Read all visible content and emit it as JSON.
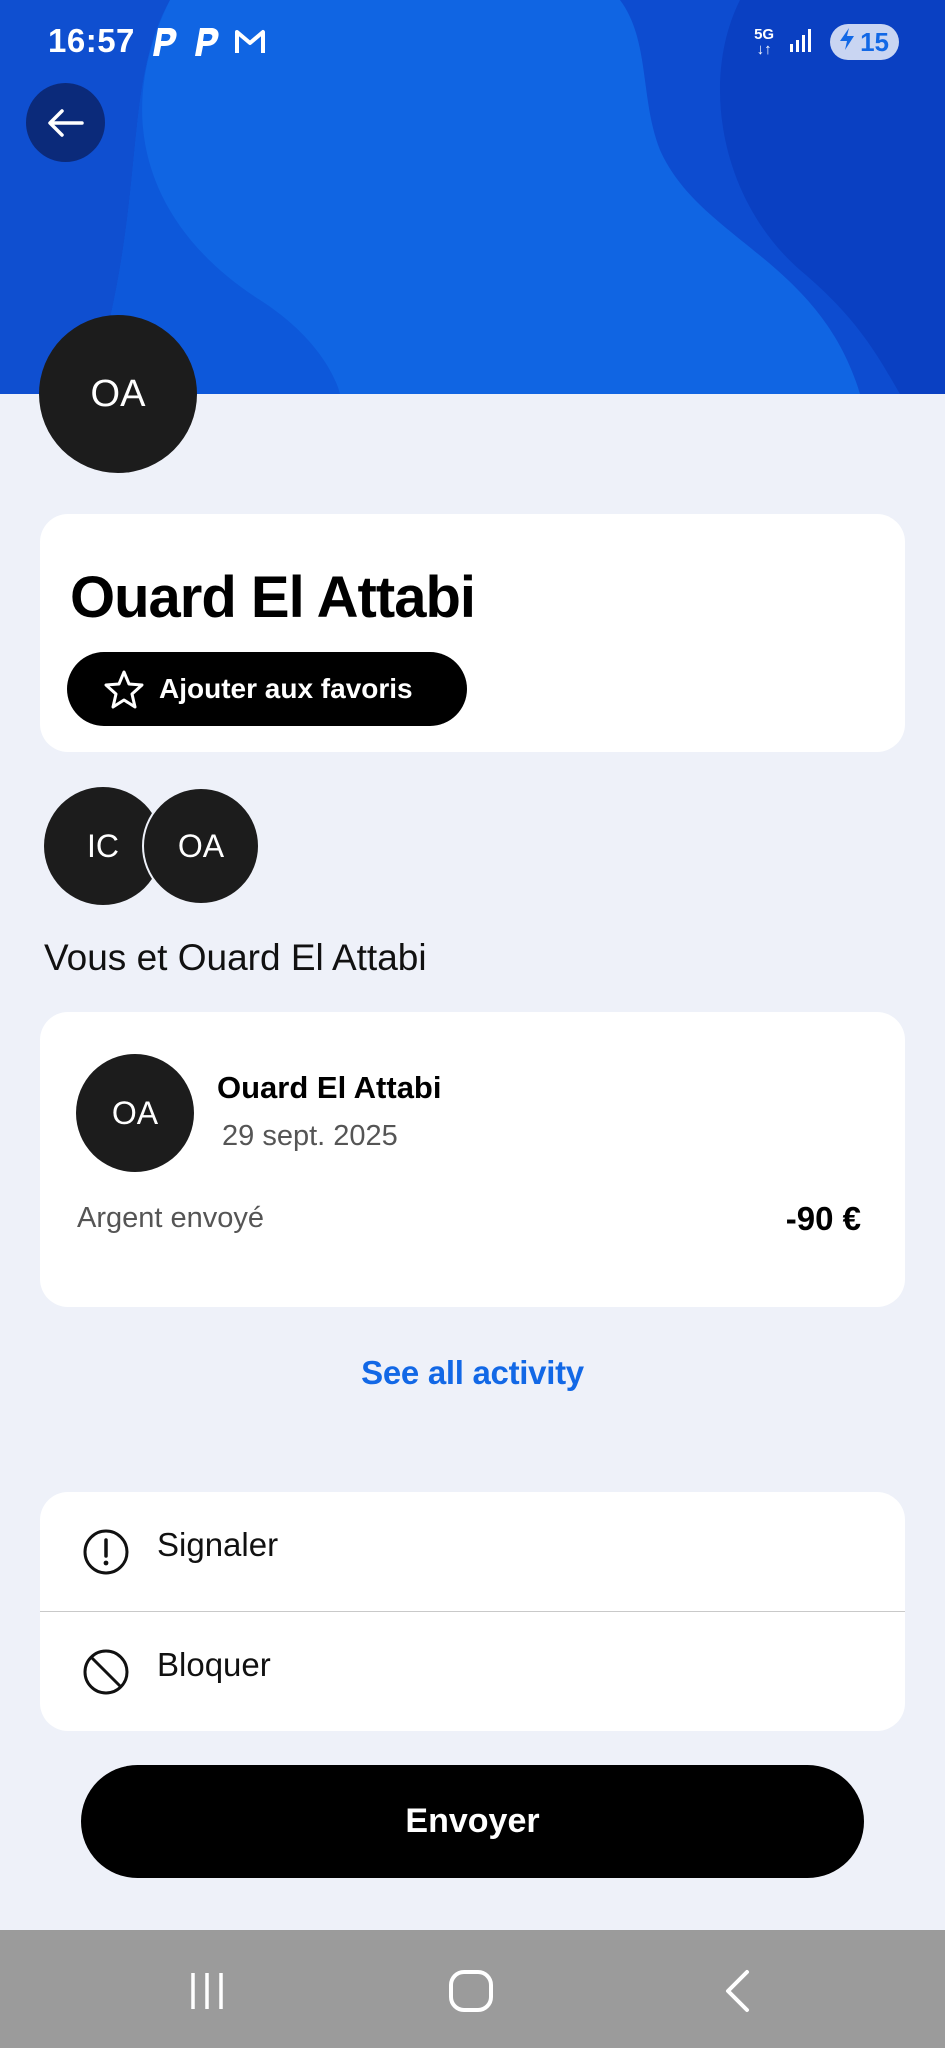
{
  "status_bar": {
    "time": "16:57",
    "network": "5G",
    "battery": "15",
    "notification_icons": [
      "paypal-icon",
      "paypal-icon",
      "gmail-icon"
    ]
  },
  "profile": {
    "initials": "OA",
    "name": "Ouard El Attabi",
    "favorite_label": "Ajouter aux favoris"
  },
  "shared": {
    "avatars": [
      "IC",
      "OA"
    ],
    "label": "Vous et Ouard El Attabi"
  },
  "activity": {
    "initials": "OA",
    "name": "Ouard El Attabi",
    "date": "29 sept. 2025",
    "type": "Argent envoyé",
    "amount": "-90 €"
  },
  "see_all_label": "See all activity",
  "menu": {
    "report_label": "Signaler",
    "block_label": "Bloquer"
  },
  "send_label": "Envoyer",
  "colors": {
    "brand_blue": "#1268e6",
    "dark_blue": "#0b2a7a",
    "background": "#eef1f9",
    "avatar": "#1c1c1c"
  }
}
